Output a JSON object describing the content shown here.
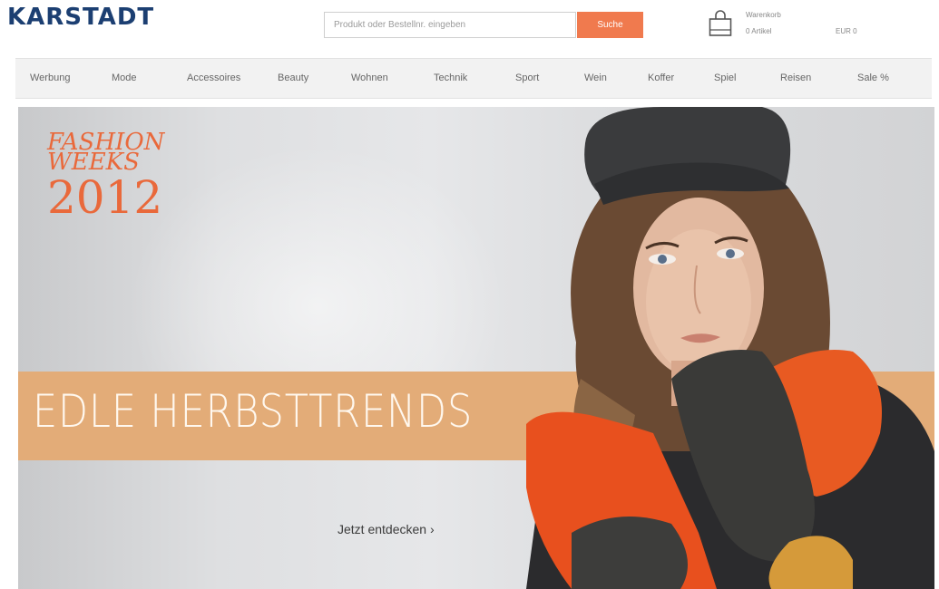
{
  "header": {
    "logo": "KARSTADT",
    "search": {
      "placeholder": "Produkt oder Bestellnr. eingeben",
      "button_label": "Suche"
    },
    "cart": {
      "icon": "shopping-bag-icon",
      "title": "Warenkorb",
      "count": "0 Artikel",
      "total": "EUR 0"
    }
  },
  "nav": {
    "items": [
      {
        "label": "Werbung"
      },
      {
        "label": "Mode"
      },
      {
        "label": "Accessoires"
      },
      {
        "label": "Beauty"
      },
      {
        "label": "Wohnen"
      },
      {
        "label": "Technik"
      },
      {
        "label": "Sport"
      },
      {
        "label": "Wein"
      },
      {
        "label": "Koffer"
      },
      {
        "label": "Spiel"
      },
      {
        "label": "Reisen"
      },
      {
        "label": "Sale %"
      }
    ]
  },
  "hero": {
    "fashion_weeks": {
      "line1": "FASHION",
      "line2": "WEEKS",
      "year": "2012"
    },
    "headline": "EDLE HERBSTTRENDS",
    "cta": "Jetzt entdecken ›"
  },
  "colors": {
    "brand_blue": "#1c3f72",
    "accent_orange": "#f07a4e",
    "banner_tan": "#e3ac78",
    "fashion_weeks_orange": "#e9693b"
  }
}
